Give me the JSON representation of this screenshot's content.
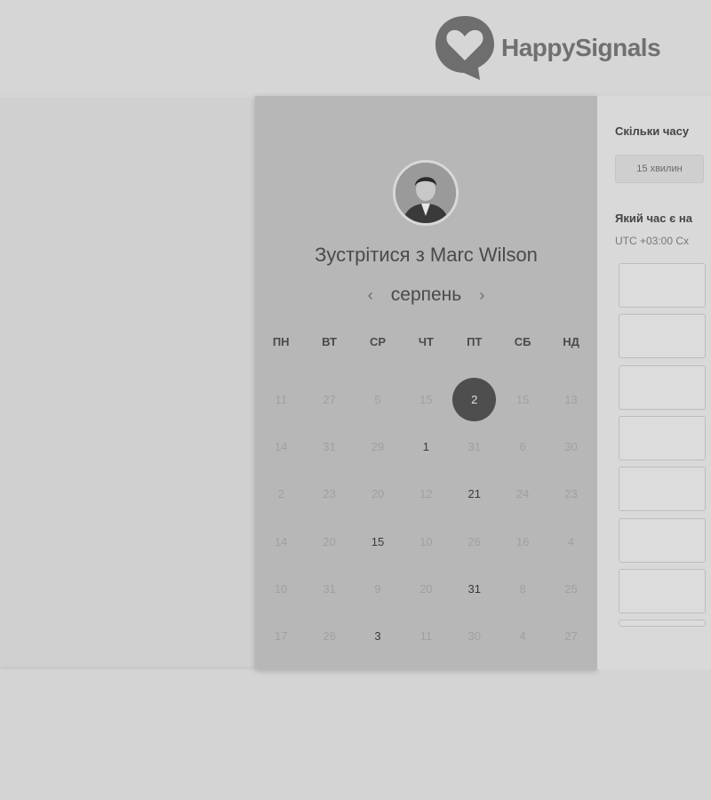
{
  "header": {
    "brand": "HappySignals"
  },
  "calendar": {
    "meet_prefix": "Зустрітися з",
    "person": "Marc Wilson",
    "month": "серпень",
    "weekdays": [
      "ПН",
      "ВТ",
      "СР",
      "ЧТ",
      "ПТ",
      "СБ",
      "НД"
    ],
    "weeks": [
      [
        "11",
        "27",
        "5",
        "15",
        "2",
        "15",
        "13"
      ],
      [
        "14",
        "31",
        "29",
        "1",
        "31",
        "6",
        "30"
      ],
      [
        "2",
        "23",
        "20",
        "12",
        "21",
        "24",
        "23"
      ],
      [
        "14",
        "20",
        "15",
        "10",
        "26",
        "16",
        "4"
      ],
      [
        "10",
        "31",
        "9",
        "20",
        "31",
        "8",
        "25"
      ],
      [
        "17",
        "26",
        "3",
        "11",
        "30",
        "4",
        "27"
      ]
    ],
    "available": [
      [
        1,
        3
      ],
      [
        2,
        4
      ],
      [
        3,
        2
      ],
      [
        4,
        4
      ],
      [
        5,
        2
      ]
    ],
    "selected": [
      0,
      4
    ]
  },
  "booking": {
    "duration_question": "Скільки часу",
    "duration_value": "15 хвилин",
    "time_question": "Який час є на",
    "timezone": "UTC +03:00 Сх"
  }
}
